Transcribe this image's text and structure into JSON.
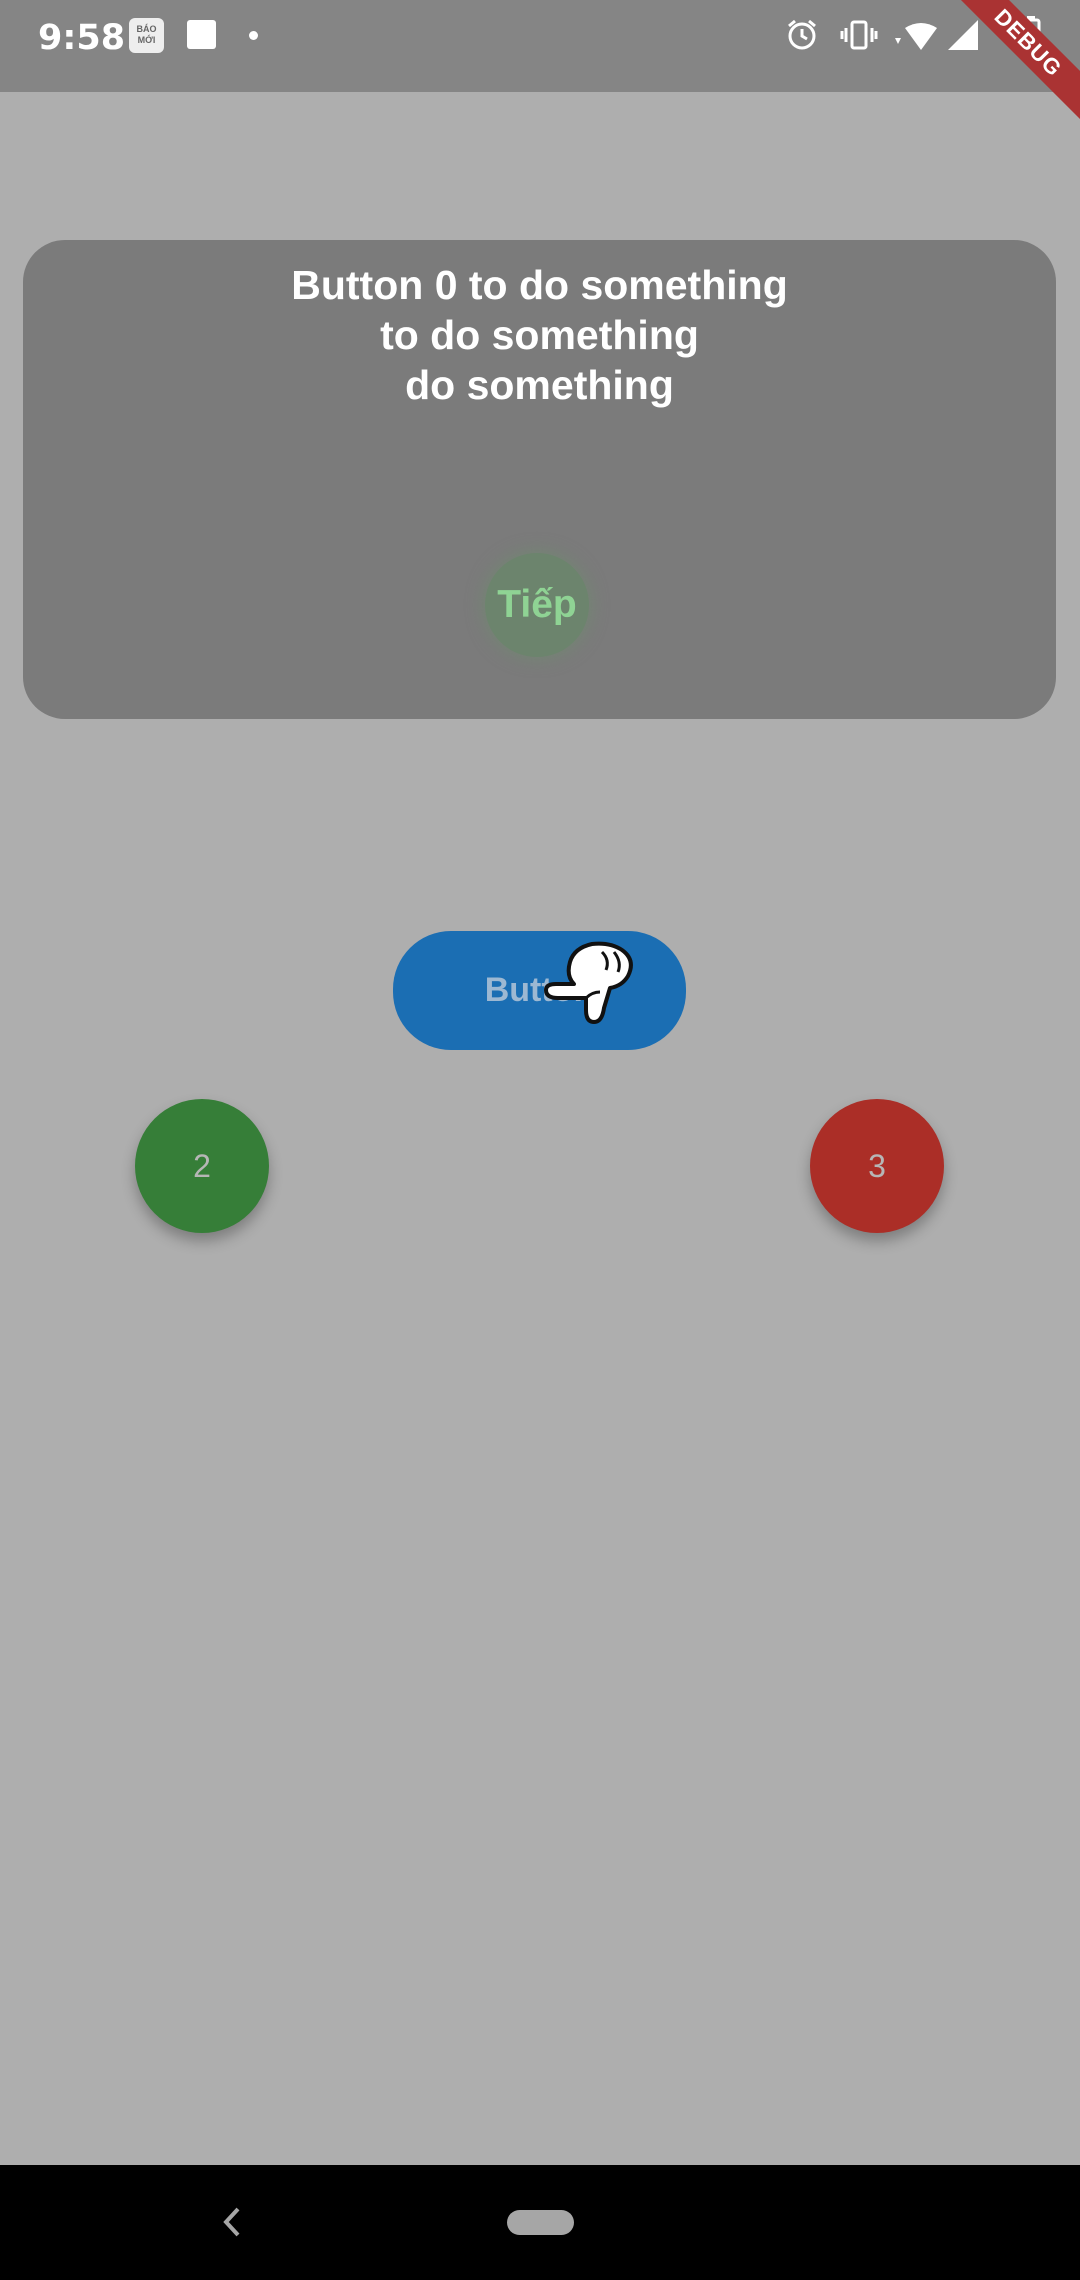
{
  "status_bar": {
    "time": "9:58",
    "news_icon_text": "BÁO MỚI",
    "icons": [
      "alarm-icon",
      "vibrate-icon",
      "wifi-icon",
      "signal-icon",
      "battery-icon"
    ],
    "debug_banner": "DEBUG"
  },
  "coach": {
    "title": "Button 0 to do something\nto do something\ndo something",
    "next_label": "Tiếp"
  },
  "main": {
    "button_label": "Button"
  },
  "fabs": {
    "green_label": "2",
    "red_label": "3"
  },
  "colors": {
    "background": "#aeaeae",
    "card": "#7b7b7b",
    "primary_button": "#1b6eb3",
    "fab_green": "#367e38",
    "fab_red": "#ab2e27",
    "next_text": "#8fd394"
  }
}
